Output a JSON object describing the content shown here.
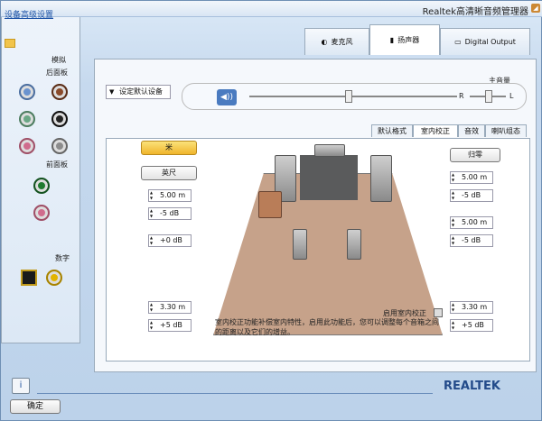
{
  "window": {
    "title": "Realtek高清晰音频管理器",
    "title_icon": "speaker-icon"
  },
  "left_panel": {
    "link": "设备高级设置",
    "analog": "模拟",
    "back_panel": "后面板",
    "front_panel": "前面板",
    "digital": "数字"
  },
  "tabs": [
    {
      "label": "Digital Output",
      "icon": "digital-output-icon"
    },
    {
      "label": "扬声器",
      "icon": "speaker-icon"
    },
    {
      "label": "麦克风",
      "icon": "microphone-icon"
    }
  ],
  "main": {
    "volume_label": "主音量",
    "left": "L",
    "right": "R",
    "default_device": "设定默认设备",
    "subtabs": [
      "喇叭组态",
      "音效",
      "室内校正",
      "默认格式"
    ],
    "room_correction": {
      "checkbox": "启用室内校正",
      "note": "室内校正功能补偿室内特性，启用此功能后，您可以调整每个音箱之间的距离以及它们的增益。",
      "buttons": {
        "meter": "米",
        "feet": "英尺",
        "reset": "归零"
      },
      "spins": [
        {
          "value": "5.00 m"
        },
        {
          "value": "-5 dB"
        },
        {
          "value": "5.00 m"
        },
        {
          "value": "-5 dB"
        },
        {
          "value": "3.30 m"
        },
        {
          "value": "+5 dB"
        },
        {
          "value": "5.00 m"
        },
        {
          "value": "-5 dB"
        },
        {
          "value": "+0 dB"
        },
        {
          "value": "3.30 m"
        },
        {
          "value": "+5 dB"
        }
      ]
    }
  },
  "footer": {
    "brand": "REALTEK",
    "ok": "确定",
    "info_icon": "info-icon"
  }
}
